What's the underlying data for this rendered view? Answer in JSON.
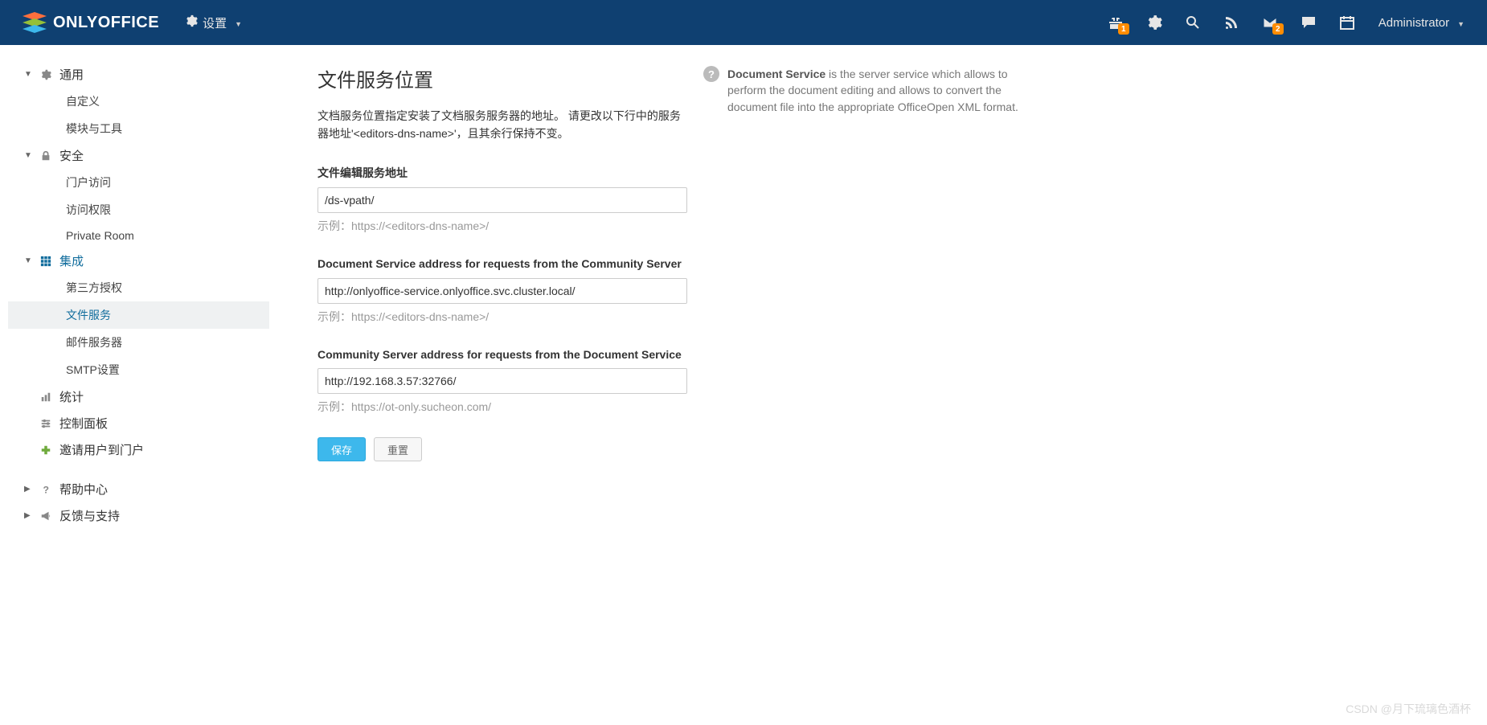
{
  "header": {
    "brand": "ONLYOFFICE",
    "settings_label": "设置",
    "user_label": "Administrator",
    "badges": {
      "gift": "1",
      "mail": "2"
    }
  },
  "sidebar": {
    "groups": [
      {
        "id": "general",
        "label": "通用",
        "icon": "gear",
        "items": [
          {
            "id": "custom",
            "label": "自定义"
          },
          {
            "id": "modules",
            "label": "模块与工具"
          }
        ]
      },
      {
        "id": "security",
        "label": "安全",
        "icon": "lock",
        "items": [
          {
            "id": "portal",
            "label": "门户访问"
          },
          {
            "id": "access",
            "label": "访问权限"
          },
          {
            "id": "private",
            "label": "Private Room"
          }
        ]
      },
      {
        "id": "integration",
        "label": "集成",
        "icon": "grid",
        "active": true,
        "items": [
          {
            "id": "thirdparty",
            "label": "第三方授权"
          },
          {
            "id": "docservice",
            "label": "文件服务",
            "selected": true
          },
          {
            "id": "mailserver",
            "label": "邮件服务器"
          },
          {
            "id": "smtp",
            "label": "SMTP设置"
          }
        ]
      },
      {
        "id": "stats",
        "label": "统计",
        "icon": "bars",
        "leaf": true
      },
      {
        "id": "panel",
        "label": "控制面板",
        "icon": "sliders",
        "leaf": true
      },
      {
        "id": "invite",
        "label": "邀请用户到门户",
        "icon": "plus",
        "leaf": true,
        "green": true
      },
      {
        "id": "help",
        "label": "帮助中心",
        "icon": "question",
        "leaf": true,
        "collapsed": true
      },
      {
        "id": "feedback",
        "label": "反馈与支持",
        "icon": "megaphone",
        "leaf": true,
        "collapsed": true
      }
    ]
  },
  "page": {
    "title": "文件服务位置",
    "description": "文档服务位置指定安装了文档服务服务器的地址。 请更改以下行中的服务器地址'<editors-dns-name>'，且其余行保持不变。",
    "fields": {
      "editing": {
        "label": "文件编辑服务地址",
        "value": "/ds-vpath/",
        "hint": "示例：https://<editors-dns-name>/"
      },
      "from_community": {
        "label": "Document Service address for requests from the Community Server",
        "value": "http://onlyoffice-service.onlyoffice.svc.cluster.local/",
        "hint": "示例：https://<editors-dns-name>/"
      },
      "from_docservice": {
        "label": "Community Server address for requests from the Document Service",
        "value": "http://192.168.3.57:32766/",
        "hint": "示例：https://ot-only.sucheon.com/"
      }
    },
    "buttons": {
      "save": "保存",
      "reset": "重置"
    },
    "info": {
      "bold": "Document Service",
      "text": " is the server service which allows to perform the document editing and allows to convert the document file into the appropriate OfficeOpen XML format."
    }
  },
  "watermark": "CSDN @月下琉璃色酒杯"
}
